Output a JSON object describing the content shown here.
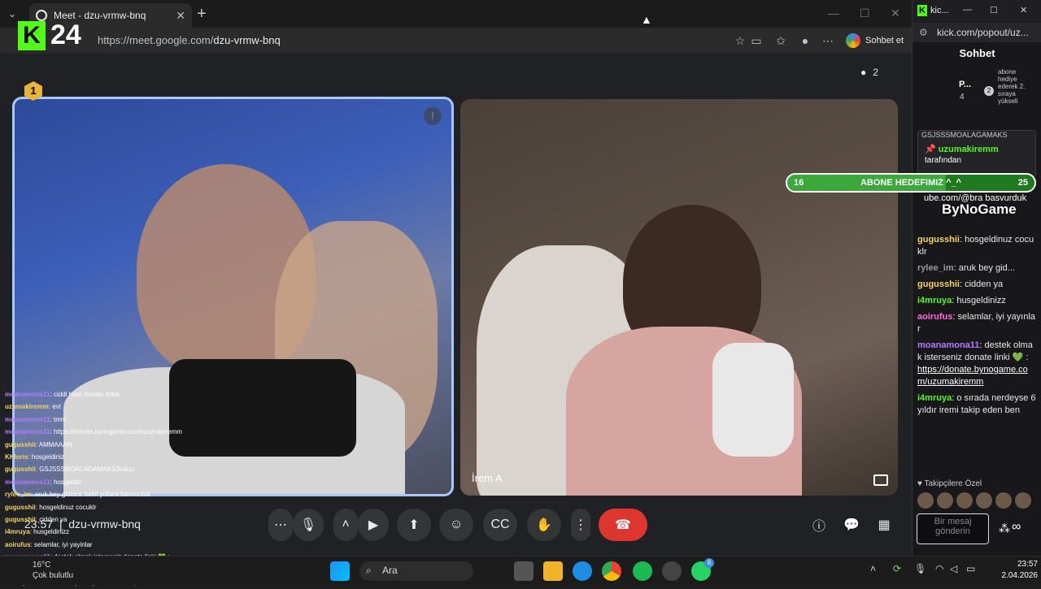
{
  "browser": {
    "tab_title": "Meet - dzu-vrmw-bnq",
    "url_host": "https://meet.google.com/",
    "url_path": "dzu-vrmw-bnq",
    "sohbet_label": "Sohbet et"
  },
  "logo": {
    "k": "K",
    "number": "24"
  },
  "meet": {
    "participant_count": "2",
    "tile2_name": "İrem A",
    "meeting_time": "23:57",
    "meeting_code": "dzu-vrmw-bnq"
  },
  "overlay_chat": [
    {
      "user": "moanamona11",
      "msg": ": ciddi hissi donate linkle"
    },
    {
      "user": "uzumakiremm",
      "msg": ": evt"
    },
    {
      "user": "moanamona11",
      "msg": ": tmm"
    },
    {
      "user": "moanamona11",
      "msg": ": https://donate.bynogame.com/uzumakiremm"
    },
    {
      "user": "gugusshii",
      "msg": ": AMMAAAN"
    },
    {
      "user": "KKloris",
      "msg": ": hosgeldiniz"
    },
    {
      "user": "gugusshii",
      "msg": ": GSJSSSMOALAGAMAKSJksksz"
    },
    {
      "user": "moanamona11",
      "msg": ": hosgeldiz"
    },
    {
      "user": "rylee_im",
      "msg": ": aruk bey gidince farkli yollara basvurduk"
    },
    {
      "user": "gugusshii",
      "msg": ": hosgeldinuz cocuklr"
    },
    {
      "user": "gugusshii",
      "msg": ": cidden ya"
    },
    {
      "user": "i4mruya",
      "msg": ": husgeldinizz"
    },
    {
      "user": "aoirufus",
      "msg": ": selamlar, iyi yayinlar"
    },
    {
      "user": "moanamona11",
      "msg": ": destek olmak isterseniz donate linki 💚 :"
    },
    {
      "user": "",
      "msg": "https://donate.bynogame.com/uzumakiremm"
    },
    {
      "user": "i4mruya",
      "msg": ": o sirada nerdeyse 6 yildir iremi takip eden ben"
    }
  ],
  "kick": {
    "window_title": "kic...",
    "address": "kick.com/popout/uz...",
    "header": "Sohbet",
    "lb_name": "P...",
    "lb_count": "4",
    "lb_rank": "1",
    "lb2_rank": "2",
    "lb2_text": "abone hediye ederek 2. sıraya yükseli",
    "pinned_top": "GSJSSSMOALAGAMAKS",
    "pinned_user": "uzumakiremm",
    "pinned_by": "tarafından",
    "pinned_msg": "ıs://www.yout ube.com/@bra basvurduk",
    "messages": [
      {
        "user": "gugusshii",
        "sep": ":",
        "text": " hosgeldinuz cocuklr",
        "color": "c-gold"
      },
      {
        "user": "rylee_im",
        "sep": ":",
        "text": " aruk bey gid...",
        "color": "c-grey"
      },
      {
        "user": "gugusshii",
        "sep": ":",
        "text": " cidden ya",
        "color": "c-gold"
      },
      {
        "user": "i4mruya",
        "sep": ":",
        "text": " husgeldinizz",
        "color": "c-green"
      },
      {
        "user": "aoirufus",
        "sep": ":",
        "text": " selamlar, iyi yayınlar",
        "color": "c-pink"
      },
      {
        "user": "moanamona11",
        "sep": "",
        "text": ": destek olmak isterseniz donate linki 💚 :",
        "color": "c-purple"
      },
      {
        "user": "i4mruya",
        "sep": ":",
        "text": " o sırada nerdeyse 6 yıldır iremi takip eden ben",
        "color": "c-green"
      }
    ],
    "donate_link": "https://donate.bynogame.com/uzumakiremm",
    "followers_label": "Takipçilere Özel",
    "input_placeholder": "Bir mesaj gönderin"
  },
  "goal": {
    "left": "16",
    "title": "ABONE HEDEFIMIZ ^_^",
    "right": "25",
    "progress": 0.64
  },
  "bynogame": "ByNoGame",
  "taskbar": {
    "search": "Ara",
    "weather_temp": "16°C",
    "weather_desc": "Çok bulutlu",
    "time": "23:57",
    "date": "2.04.2026",
    "whatsapp_badge": "6"
  }
}
